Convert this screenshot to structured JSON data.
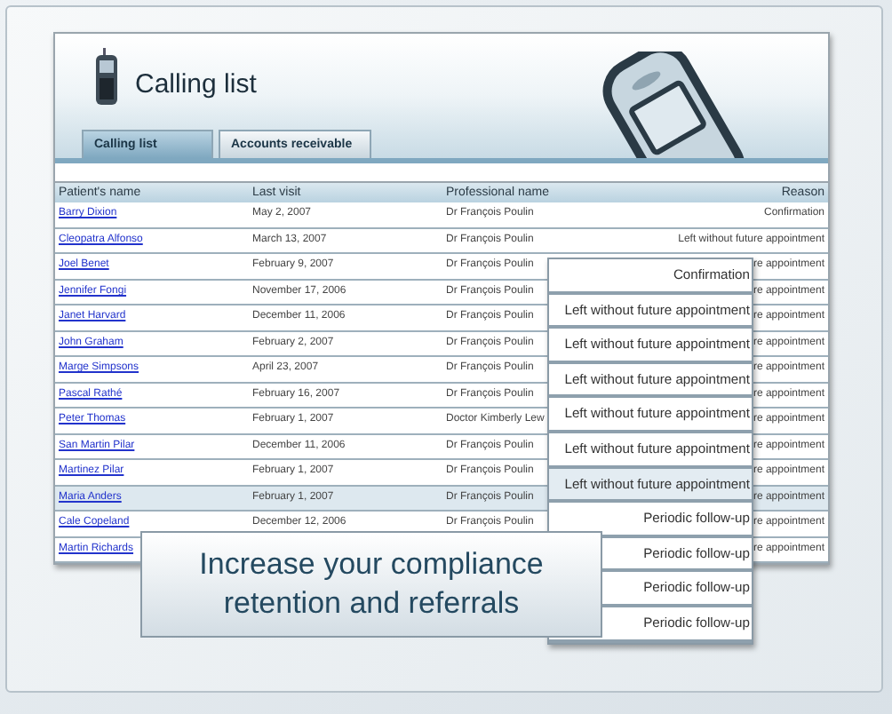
{
  "header": {
    "title": "Calling list"
  },
  "tabs": [
    {
      "label": "Calling list",
      "selected": true
    },
    {
      "label": "Accounts receivable",
      "selected": false
    }
  ],
  "table": {
    "columns": [
      "Patient's name",
      "Last visit",
      "Professional name",
      "Reason"
    ],
    "rows": [
      {
        "patient": "Barry Dixion",
        "last_visit": "May 2, 2007",
        "professional": "Dr François Poulin",
        "reason": "Confirmation",
        "selected": false
      },
      {
        "patient": "Cleopatra Alfonso",
        "last_visit": "March 13, 2007",
        "professional": "Dr François Poulin",
        "reason": "Left without future appointment",
        "selected": false
      },
      {
        "patient": "Joel Benet",
        "last_visit": "February 9, 2007",
        "professional": "Dr François Poulin",
        "reason": "re appointment",
        "selected": false
      },
      {
        "patient": "Jennifer Fongi",
        "last_visit": "November 17, 2006",
        "professional": "Dr François Poulin",
        "reason": "re appointment",
        "selected": false
      },
      {
        "patient": "Janet Harvard",
        "last_visit": "December 11, 2006",
        "professional": "Dr François Poulin",
        "reason": "re appointment",
        "selected": false
      },
      {
        "patient": "John Graham",
        "last_visit": "February 2, 2007",
        "professional": "Dr François Poulin",
        "reason": "re appointment",
        "selected": false
      },
      {
        "patient": "Marge Simpsons",
        "last_visit": "April 23, 2007",
        "professional": "Dr François Poulin",
        "reason": "re appointment",
        "selected": false
      },
      {
        "patient": "Pascal Rathé",
        "last_visit": "February 16, 2007",
        "professional": "Dr François Poulin",
        "reason": "re appointment",
        "selected": false
      },
      {
        "patient": "Peter Thomas",
        "last_visit": "February 1, 2007",
        "professional": "Doctor Kimberly Lew",
        "reason": "re appointment",
        "selected": false
      },
      {
        "patient": "San Martin Pilar",
        "last_visit": "December 11, 2006",
        "professional": "Dr François Poulin",
        "reason": "re appointment",
        "selected": false
      },
      {
        "patient": "Martinez Pilar",
        "last_visit": "February 1, 2007",
        "professional": "Dr François Poulin",
        "reason": "re appointment",
        "selected": false
      },
      {
        "patient": "Maria Anders",
        "last_visit": "February 1, 2007",
        "professional": "Dr François Poulin",
        "reason": "re appointment",
        "selected": true
      },
      {
        "patient": "Cale Copeland",
        "last_visit": "December 12, 2006",
        "professional": "Dr François Poulin",
        "reason": "re appointment",
        "selected": false
      },
      {
        "patient": "Martin Richards",
        "reason": "re appointment",
        "selected": false
      }
    ]
  },
  "zoom_list": {
    "items": [
      {
        "text": "Confirmation",
        "selected": false
      },
      {
        "text": "Left without future appointment",
        "selected": false
      },
      {
        "text": "Left without future appointment",
        "selected": false
      },
      {
        "text": "Left without future appointment",
        "selected": false
      },
      {
        "text": "Left without future appointment",
        "selected": false
      },
      {
        "text": "Left without future appointment",
        "selected": false
      },
      {
        "text": "Left without future appointment",
        "selected": true
      },
      {
        "text": "Periodic follow-up",
        "selected": false
      },
      {
        "text": "Periodic follow-up",
        "selected": false
      },
      {
        "text": "Periodic follow-up",
        "selected": false
      },
      {
        "text": "Periodic follow-up",
        "selected": false
      }
    ]
  },
  "callout": {
    "text": "Increase your compliance retention and referrals"
  }
}
